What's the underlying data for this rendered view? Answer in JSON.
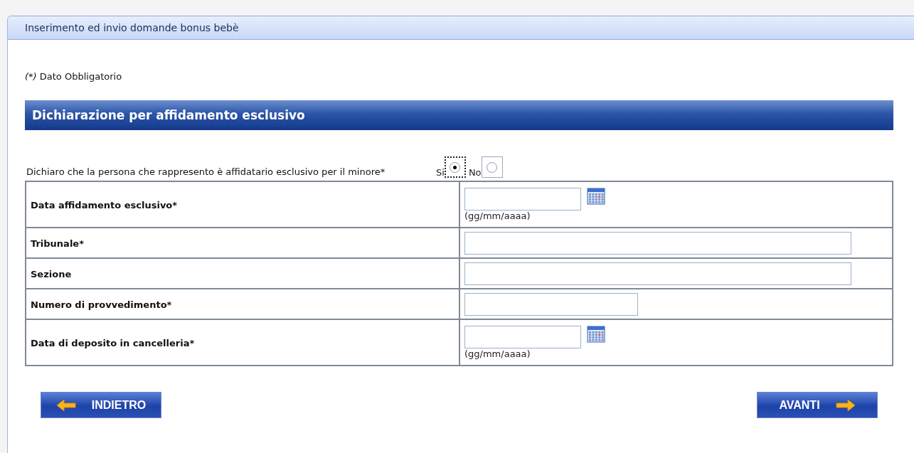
{
  "panel": {
    "title": "Inserimento ed invio domande bonus bebè"
  },
  "legend": {
    "mark": "(*)",
    "text": "Dato Obbligatorio"
  },
  "section": {
    "title": "Dichiarazione per affidamento esclusivo"
  },
  "question": {
    "text": "Dichiaro che la persona che rappresento è affidatario esclusivo per il minore*",
    "options": [
      {
        "label": "Si",
        "selected": true
      },
      {
        "label": "No",
        "selected": false
      }
    ]
  },
  "rows": [
    {
      "label": "Data affidamento esclusivo*",
      "kind": "date",
      "hint": "(gg/mm/aaaa)"
    },
    {
      "label": "Tribunale*",
      "kind": "wide"
    },
    {
      "label": "Sezione",
      "kind": "wide"
    },
    {
      "label": "Numero di provvedimento*",
      "kind": "narrow"
    },
    {
      "label": "Data di deposito in cancelleria*",
      "kind": "date",
      "hint": "(gg/mm/aaaa)"
    }
  ],
  "buttons": [
    {
      "label": "INDIETRO",
      "kind": "back"
    },
    {
      "label": "AVANTI",
      "kind": "next"
    }
  ]
}
